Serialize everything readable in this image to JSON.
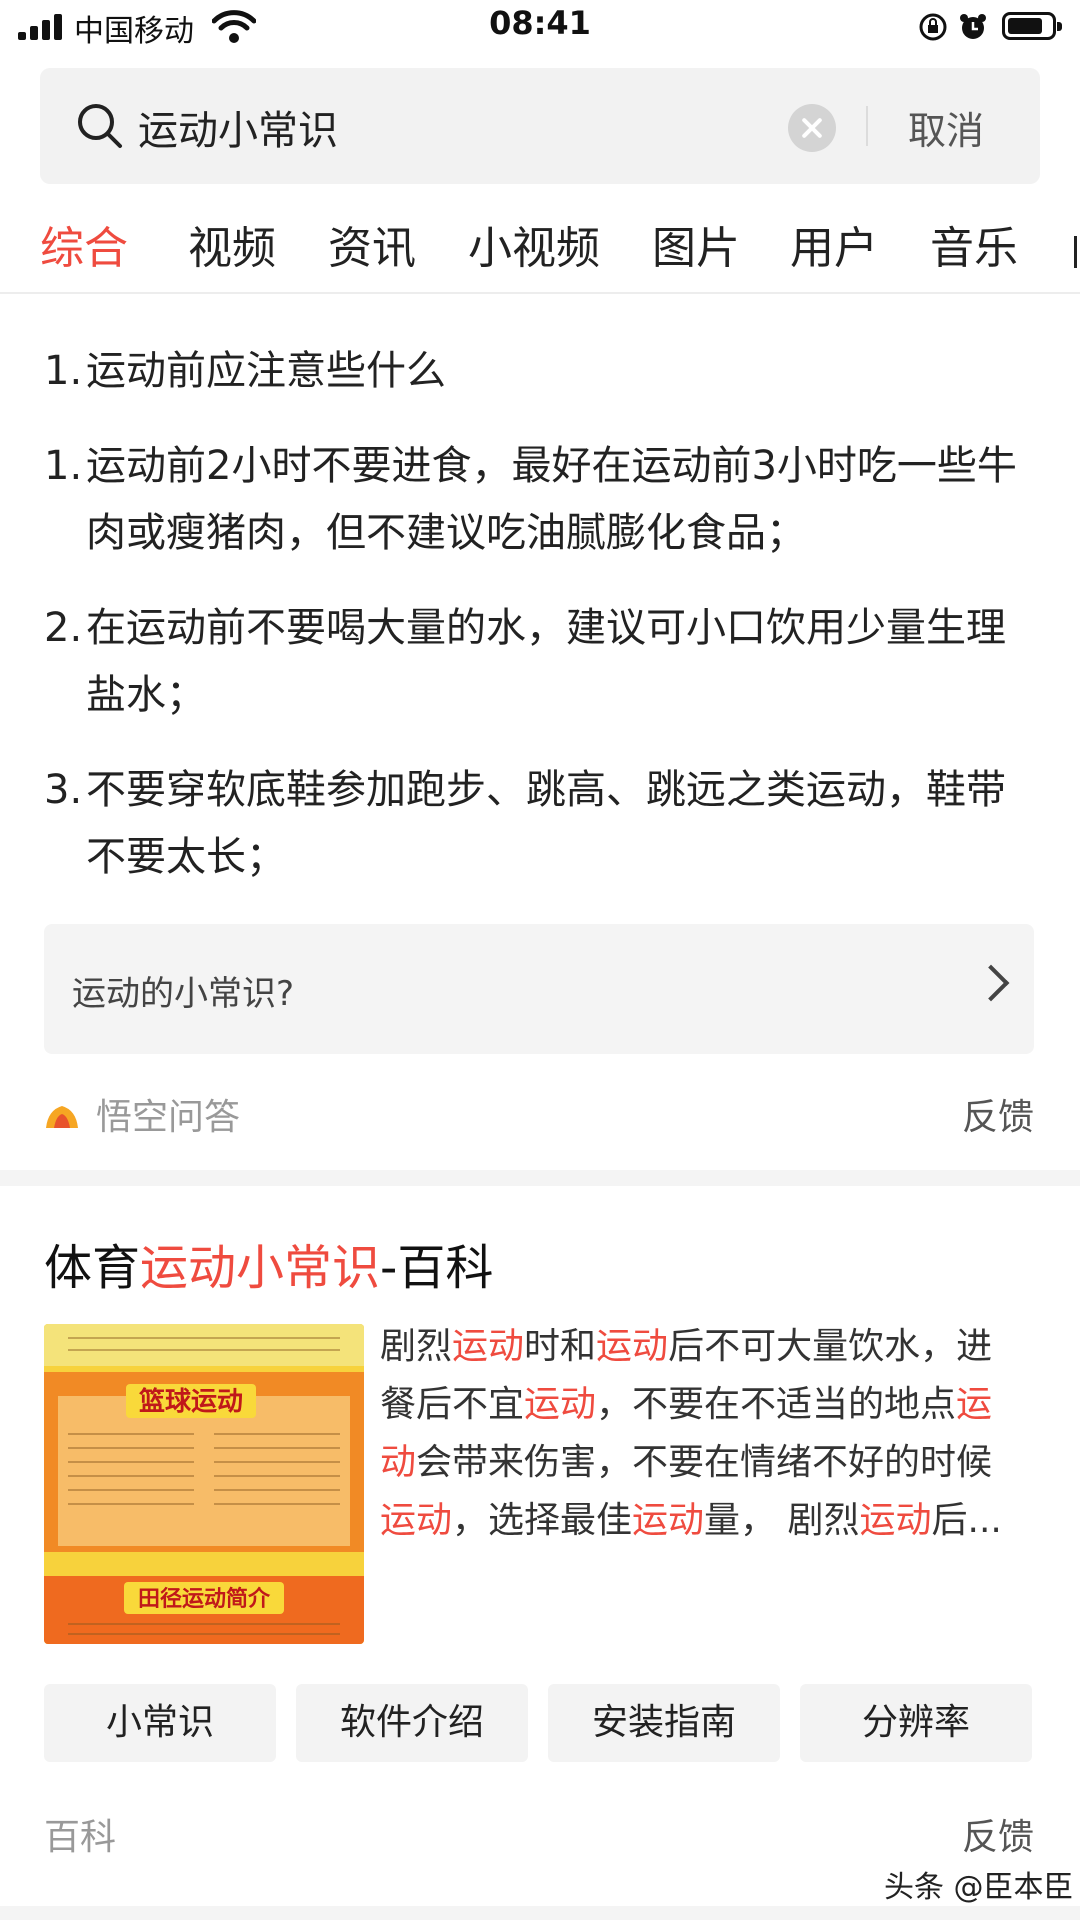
{
  "status_bar": {
    "carrier": "中国移动",
    "time": "08:41"
  },
  "search": {
    "query": "运动小常识",
    "cancel_label": "取消"
  },
  "tabs": [
    {
      "label": "综合",
      "active": true
    },
    {
      "label": "视频",
      "active": false
    },
    {
      "label": "资讯",
      "active": false
    },
    {
      "label": "小视频",
      "active": false
    },
    {
      "label": "图片",
      "active": false
    },
    {
      "label": "用户",
      "active": false
    },
    {
      "label": "音乐",
      "active": false
    }
  ],
  "qa_card": {
    "items": [
      {
        "num": "1.",
        "text": "运动前应注意些什么"
      },
      {
        "num": "1.",
        "text": "运动前2小时不要进食，最好在运动前3小时吃一些牛肉或瘦猪肉，但不建议吃油腻膨化食品；"
      },
      {
        "num": "2.",
        "text": "在运动前不要喝大量的水，建议可小口饮用少量生理盐水；"
      },
      {
        "num": "3.",
        "text": "不要穿软底鞋参加跑步、跳高、跳远之类运动，鞋带不要太长；"
      }
    ],
    "related_question": "运动的小常识?",
    "source": "悟空问答",
    "feedback": "反馈"
  },
  "baike_card": {
    "title_prefix": "体育",
    "title_highlight": "运动小常识",
    "title_suffix": "-百科",
    "thumb_text_1": "篮球运动",
    "thumb_text_2": "田径运动简介",
    "snippet_segments": [
      {
        "t": "剧烈",
        "hl": false
      },
      {
        "t": "运动",
        "hl": true
      },
      {
        "t": "时和",
        "hl": false
      },
      {
        "t": "运动",
        "hl": true
      },
      {
        "t": "后不可大量饮水，进餐后不宜",
        "hl": false
      },
      {
        "t": "运动",
        "hl": true
      },
      {
        "t": "，不要在不适当的地点",
        "hl": false
      },
      {
        "t": "运动",
        "hl": true
      },
      {
        "t": "会带来伤害，不要在情绪不好的时候",
        "hl": false
      },
      {
        "t": "运动",
        "hl": true
      },
      {
        "t": "，选择最佳",
        "hl": false
      },
      {
        "t": "运动",
        "hl": true
      },
      {
        "t": "量， 剧烈",
        "hl": false
      },
      {
        "t": "运动",
        "hl": true
      },
      {
        "t": "后...",
        "hl": false
      }
    ],
    "chips": [
      "小常识",
      "软件介绍",
      "安装指南",
      "分辨率"
    ],
    "source": "百科",
    "feedback": "反馈"
  },
  "watermark": "头条 @臣本臣",
  "colors": {
    "accent": "#ef4b3f",
    "chip_bg": "#f3f3f3"
  }
}
